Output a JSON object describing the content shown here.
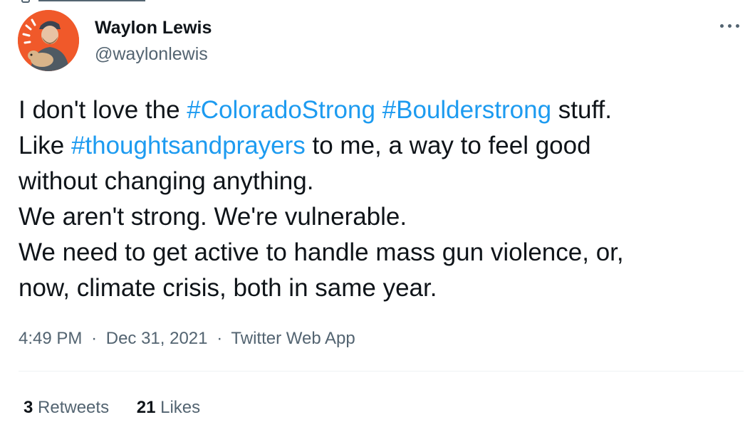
{
  "tweet": {
    "author": {
      "name": "Waylon Lewis",
      "handle": "@waylonlewis",
      "avatar_bg": "#f0592a"
    },
    "text": {
      "line1": {
        "a": "I don't love the ",
        "hashtag1": "#ColoradoStrong",
        "b": " ",
        "hashtag2": "#Boulderstrong",
        "c": " stuff."
      },
      "line2": {
        "a": "Like ",
        "hashtag": "#thoughtsandprayers",
        "b": " to me, a way to feel good"
      },
      "line3": "without changing anything.",
      "line4": "We aren't strong. We're vulnerable.",
      "line5": "We need to get active to handle mass gun violence, or,",
      "line6": "now, climate crisis, both in same year."
    },
    "meta": {
      "time": "4:49 PM",
      "separator": "·",
      "date": "Dec 31, 2021",
      "source": "Twitter Web App"
    },
    "stats": {
      "retweets_count": "3",
      "retweets_label": "Retweets",
      "likes_count": "21",
      "likes_label": "Likes"
    },
    "colors": {
      "text": "#0f1419",
      "secondary": "#536471",
      "hashtag": "#1d9bf0",
      "divider": "#eff3f4"
    },
    "icons": {
      "more": "more-horizontal-icon"
    }
  }
}
